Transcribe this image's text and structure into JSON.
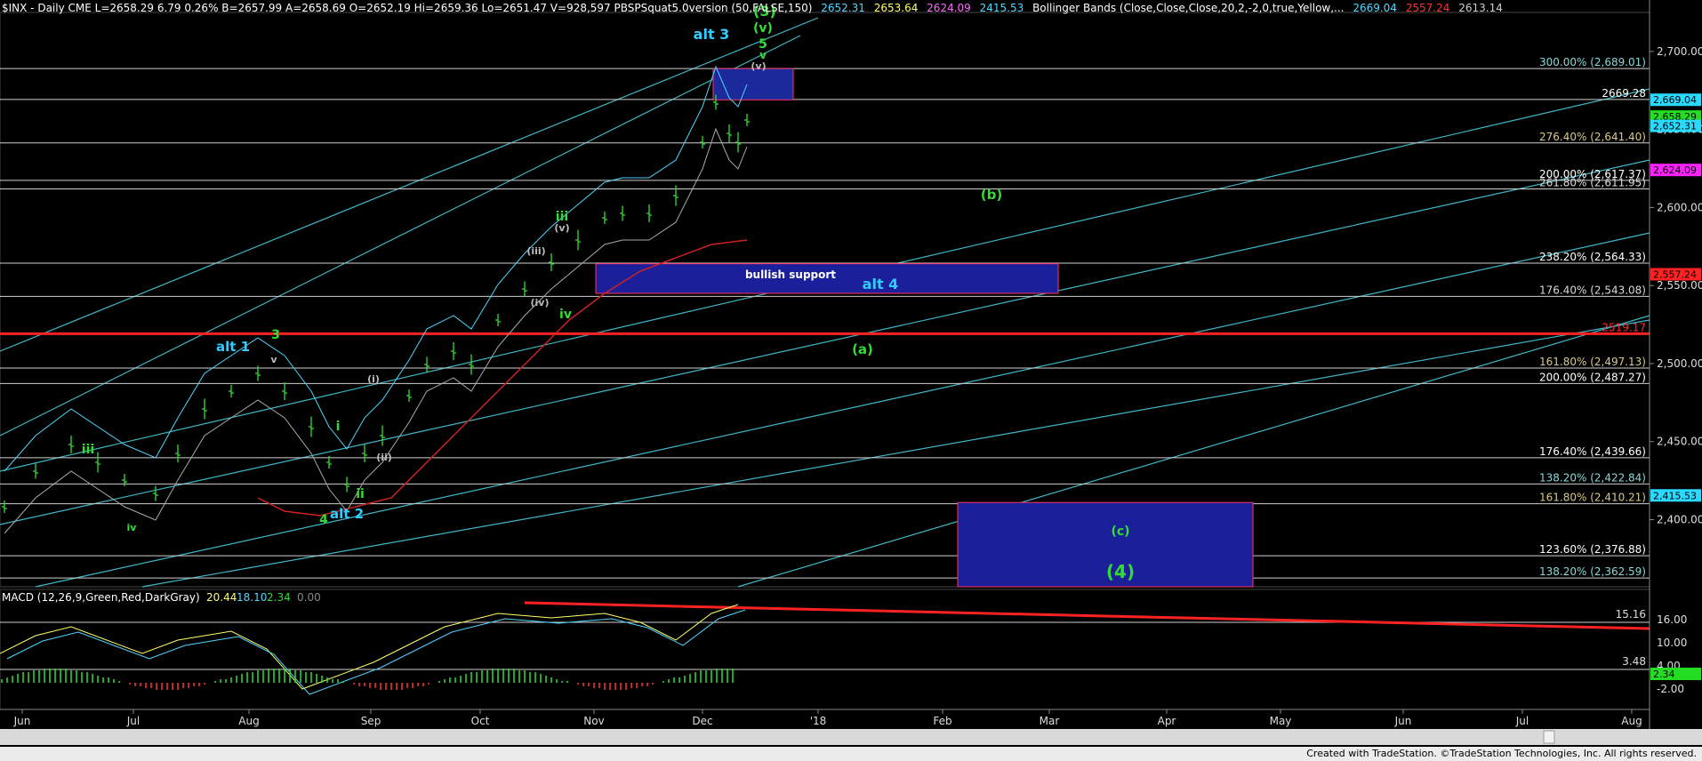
{
  "header": {
    "symbol_line": "$INX - Daily  CME  L=2658.29  6.79  0.26%  B=2657.99  A=2658.69  O=2652.19  Hi=2659.36  Lo=2651.47  V=928,597  PBSPSquat5.0version (50,FALSE,150)",
    "ind_values": [
      {
        "text": "2652.31",
        "color": "#4fd6ff"
      },
      {
        "text": "2653.64",
        "color": "#ffff66"
      },
      {
        "text": "2624.09",
        "color": "#ff66ff"
      },
      {
        "text": "2415.53",
        "color": "#4fd6ff"
      }
    ],
    "bb_label": "Bollinger Bands (Close,Close,Close,20,2,-2,0,true,Yellow,...",
    "bb_values": [
      {
        "text": "2669.04",
        "color": "#4fd6ff"
      },
      {
        "text": "2557.24",
        "color": "#ff3333"
      },
      {
        "text": "2613.14",
        "color": "#cccccc"
      }
    ]
  },
  "footer": {
    "credit": "Created with TradeStation. ©TradeStation Technologies, Inc. All rights reserved."
  },
  "chart_data": {
    "type": "candlestick",
    "title": "$INX - Daily",
    "yaxis": {
      "min": 2357,
      "max": 2725,
      "ticks": [
        "2,400.00",
        "2,450.00",
        "2,500.00",
        "2,550.00",
        "2,600.00",
        "2,650.00",
        "2,700.00"
      ]
    },
    "xaxis": {
      "labels": [
        "Jun",
        "Jul",
        "Aug",
        "Sep",
        "Oct",
        "Nov",
        "Dec",
        "'18",
        "Feb",
        "Mar",
        "Apr",
        "May",
        "Jun",
        "Jul",
        "Aug"
      ]
    },
    "fib_levels": [
      {
        "label": "300.00% (2,689.01)",
        "value": 2689.01,
        "color": "#8ad7d7"
      },
      {
        "label": "2669.28",
        "value": 2669.28,
        "color": "#ffffff"
      },
      {
        "label": "276.40% (2,641.40)",
        "value": 2641.4,
        "color": "#d9c98a"
      },
      {
        "label": "200.00% (2,617.37)",
        "value": 2617.37,
        "color": "#ffffff"
      },
      {
        "label": "261.80% (2,611.95)",
        "value": 2611.95,
        "color": "#d9d9d9"
      },
      {
        "label": "238.20% (2,564.33)",
        "value": 2564.33,
        "color": "#ffffff"
      },
      {
        "label": "176.40% (2,543.08)",
        "value": 2543.08,
        "color": "#d9d9d9"
      },
      {
        "label": "2519.17",
        "value": 2519.17,
        "color": "#ff2a2a"
      },
      {
        "label": "161.80% (2,497.13)",
        "value": 2497.13,
        "color": "#d9c98a"
      },
      {
        "label": "200.00% (2,487.27)",
        "value": 2487.27,
        "color": "#ffffff"
      },
      {
        "label": "176.40% (2,439.66)",
        "value": 2439.66,
        "color": "#ffffff"
      },
      {
        "label": "138.20% (2,422.84)",
        "value": 2422.84,
        "color": "#8ad7d7"
      },
      {
        "label": "161.80% (2,410.21)",
        "value": 2410.21,
        "color": "#d9c98a"
      },
      {
        "label": "123.60% (2,376.88)",
        "value": 2376.88,
        "color": "#ffffff"
      },
      {
        "label": "138.20% (2,362.59)",
        "value": 2362.59,
        "color": "#8ad7d7"
      }
    ],
    "price_badges": [
      {
        "text": "2,669.04",
        "value": 2669.04,
        "bg": "#2ad9ff",
        "fg": "#000"
      },
      {
        "text": "2,658.29",
        "value": 2658.29,
        "bg": "#22dd22",
        "fg": "#000"
      },
      {
        "text": "2,652.31",
        "value": 2652.31,
        "bg": "#2ad9ff",
        "fg": "#000"
      },
      {
        "text": "2,624.09",
        "value": 2624.09,
        "bg": "#ff22ff",
        "fg": "#000"
      },
      {
        "text": "2,557.24",
        "value": 2557.24,
        "bg": "#ff2222",
        "fg": "#000"
      },
      {
        "text": "2,415.53",
        "value": 2415.53,
        "bg": "#2ad9ff",
        "fg": "#000"
      }
    ],
    "wave_labels": [
      {
        "text": "alt 3",
        "color": "#33ccff"
      },
      {
        "text": "(3)",
        "color": "#33dd33"
      },
      {
        "text": "(v)",
        "color": "#33dd33"
      },
      {
        "text": "5",
        "color": "#33dd33"
      },
      {
        "text": "v",
        "color": "#33dd33"
      },
      {
        "text": "(v)",
        "color": "#bbbbbb"
      },
      {
        "text": "iii",
        "color": "#33dd33"
      },
      {
        "text": "(v)",
        "color": "#bbbbbb"
      },
      {
        "text": "(iii)",
        "color": "#bbbbbb"
      },
      {
        "text": "(iv)",
        "color": "#bbbbbb"
      },
      {
        "text": "iv",
        "color": "#33dd33"
      },
      {
        "text": "(b)",
        "color": "#33dd33"
      },
      {
        "text": "bullish support",
        "color": "#ffffff"
      },
      {
        "text": "alt 4",
        "color": "#33ccff"
      },
      {
        "text": "(a)",
        "color": "#33dd33"
      },
      {
        "text": "alt 1",
        "color": "#33ccff"
      },
      {
        "text": "3",
        "color": "#33dd33"
      },
      {
        "text": "v",
        "color": "#bbbbbb"
      },
      {
        "text": "iii",
        "color": "#33dd33"
      },
      {
        "text": "i",
        "color": "#33dd33"
      },
      {
        "text": "(i)",
        "color": "#bbbbbb"
      },
      {
        "text": "(ii)",
        "color": "#bbbbbb"
      },
      {
        "text": "ii",
        "color": "#33dd33"
      },
      {
        "text": "iv",
        "color": "#33dd33"
      },
      {
        "text": "4",
        "color": "#33dd33"
      },
      {
        "text": "alt 2",
        "color": "#33ccff"
      },
      {
        "text": "(c)",
        "color": "#33dd33"
      },
      {
        "text": "(4)",
        "color": "#33dd33"
      }
    ],
    "macd": {
      "label": "MACD (12,26,9,Green,Red,DarkGray)",
      "values": [
        {
          "text": "20.44",
          "color": "#ffff66"
        },
        {
          "text": "18.10",
          "color": "#4fd6ff"
        },
        {
          "text": "2.34",
          "color": "#33dd33"
        },
        {
          "text": "0.00",
          "color": "#888888"
        }
      ],
      "ticks": [
        "16.00",
        "10.00",
        "4.00",
        "-2.00"
      ],
      "levels": [
        "15.16",
        "3.48"
      ],
      "badge": "2.34"
    }
  }
}
